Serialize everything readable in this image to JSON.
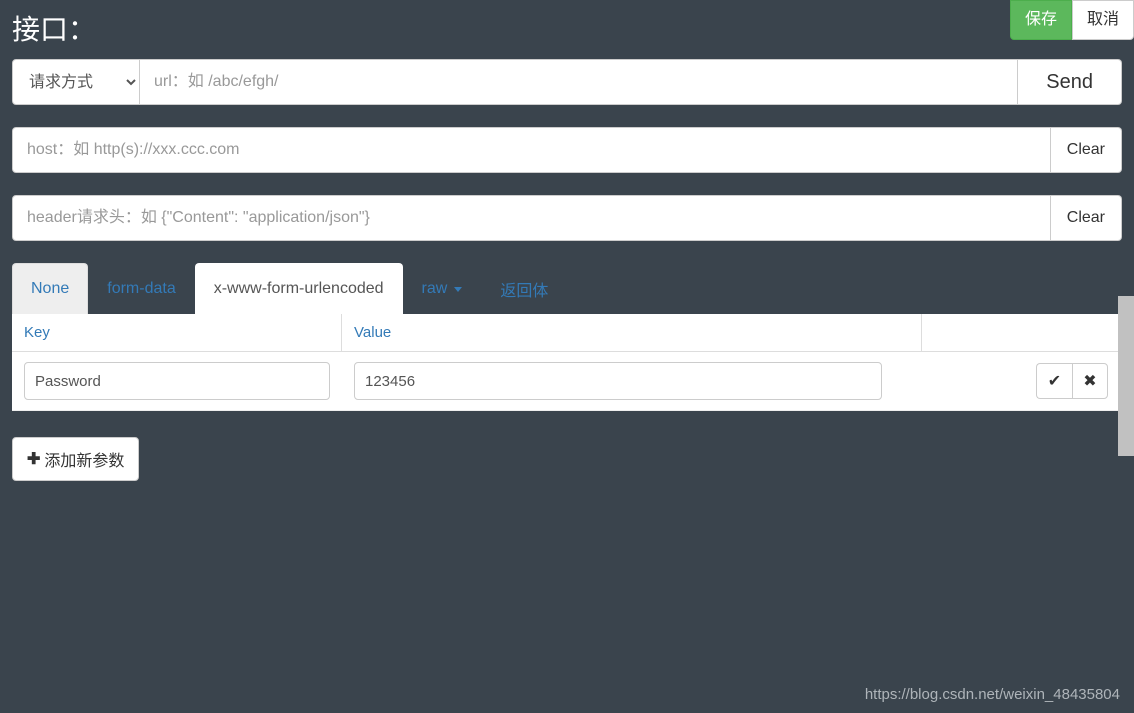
{
  "header": {
    "title": "接口：",
    "save_label": "保存",
    "cancel_label": "取消"
  },
  "request": {
    "method_label": "请求方式",
    "url_placeholder": "url：如 /abc/efgh/",
    "send_label": "Send",
    "host_placeholder": "host：如 http(s)://xxx.ccc.com",
    "header_placeholder": "header请求头：如 {\"Content\": \"application/json\"}",
    "clear_label": "Clear"
  },
  "tabs": {
    "none": "None",
    "form_data": "form-data",
    "urlencoded": "x-www-form-urlencoded",
    "raw": "raw",
    "response": "返回体"
  },
  "params": {
    "key_header": "Key",
    "value_header": "Value",
    "rows": [
      {
        "key": "Password",
        "value": "123456"
      }
    ],
    "add_label": "添加新参数"
  },
  "footer": {
    "url": "https://blog.csdn.net/weixin_48435804"
  }
}
